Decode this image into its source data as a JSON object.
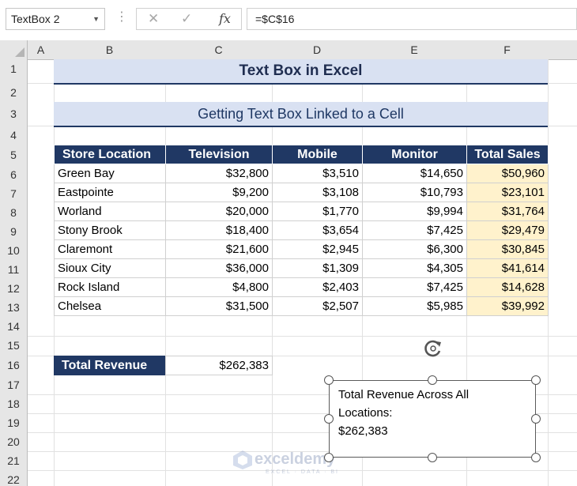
{
  "formula_bar": {
    "name_box": "TextBox 2",
    "cancel_icon": "✕",
    "enter_icon": "✓",
    "fx_label": "fx",
    "formula": "=$C$16"
  },
  "columns": [
    "A",
    "B",
    "C",
    "D",
    "E",
    "F"
  ],
  "rows": [
    "1",
    "2",
    "3",
    "4",
    "5",
    "6",
    "7",
    "8",
    "9",
    "10",
    "11",
    "12",
    "13",
    "14",
    "15",
    "16",
    "17",
    "18",
    "19",
    "20",
    "21",
    "22"
  ],
  "sheet": {
    "title": "Text Box in Excel",
    "subtitle": "Getting Text Box Linked to a Cell",
    "headers": [
      "Store Location",
      "Television",
      "Mobile",
      "Monitor",
      "Total Sales"
    ],
    "rows": [
      [
        "Green Bay",
        "$32,800",
        "$3,510",
        "$14,650",
        "$50,960"
      ],
      [
        "Eastpointe",
        "$9,200",
        "$3,108",
        "$10,793",
        "$23,101"
      ],
      [
        "Worland",
        "$20,000",
        "$1,770",
        "$9,994",
        "$31,764"
      ],
      [
        "Stony Brook",
        "$18,400",
        "$3,654",
        "$7,425",
        "$29,479"
      ],
      [
        "Claremont",
        "$21,600",
        "$2,945",
        "$6,300",
        "$30,845"
      ],
      [
        "Sioux City",
        "$36,000",
        "$1,309",
        "$4,305",
        "$41,614"
      ],
      [
        "Rock Island",
        "$4,800",
        "$2,403",
        "$7,425",
        "$14,628"
      ],
      [
        "Chelsea",
        "$31,500",
        "$2,507",
        "$5,985",
        "$39,992"
      ]
    ],
    "total_label": "Total Revenue",
    "total_value": "$262,383"
  },
  "textbox": {
    "line1": "Total Revenue Across All",
    "line2": "Locations:",
    "line3": "$262,383"
  },
  "watermark": {
    "brand": "exceldemy",
    "tagline": "EXCEL · DATA · BI"
  },
  "colors": {
    "header_fill": "#203864",
    "title_fill": "#d9e1f2",
    "total_sales_fill": "#fff2cc"
  }
}
